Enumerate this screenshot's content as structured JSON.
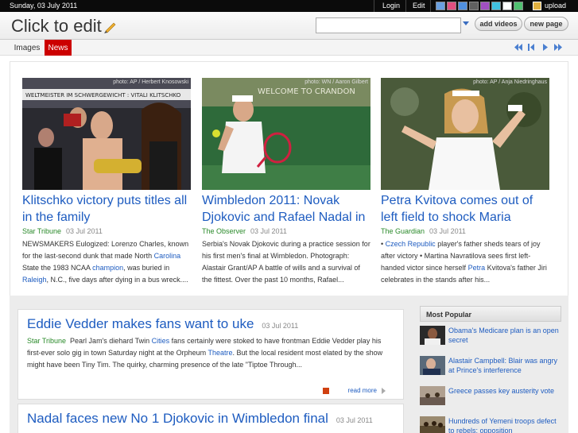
{
  "topbar": {
    "date": "Sunday, 03 July 2011",
    "login": "Login",
    "edit": "Edit",
    "swatches": [
      "#6aa0e0",
      "#e05080",
      "#5090e0",
      "#606060",
      "#a050c0",
      "#40c0e0",
      "#ffffff",
      "#50c070"
    ],
    "upload": "upload"
  },
  "header": {
    "title": "Click to edit",
    "search_value": "",
    "add_videos": "add videos",
    "new_page": "new page"
  },
  "nav": {
    "tabs": [
      "Images",
      "News"
    ],
    "active_tab": "News"
  },
  "features": [
    {
      "credit": "photo: AP / Herbert Knosowski",
      "title": "Klitschko victory puts titles all in the family",
      "source": "Star Tribune",
      "date": "03 Jul 2011",
      "ex_a": "NEWSMAKERS Eulogized: Lorenzo Charles, known for the last-second dunk that made North ",
      "ex_link1": "Carolina",
      "ex_b": " State the 1983 NCAA ",
      "ex_link2": "champion",
      "ex_c": ", was buried in ",
      "ex_link3": "Raleigh",
      "ex_d": ", N.C., five days after dying in a bus wreck...."
    },
    {
      "credit": "photo: WN / Aaron Gilbert",
      "title": "Wimbledon 2011: Novak Djokovic and Rafael Nadal in",
      "source": "The Observer",
      "date": "03 Jul 2011",
      "excerpt": "Serbia's Novak Djokovic during a practice session for his first men's final at Wimbledon. Photograph: Alastair Grant/AP A battle of wills and a survival of the fittest. Over the past 10 months, Rafael..."
    },
    {
      "credit": "photo: AP / Anja Niedringhaus",
      "title": "Petra Kvitova comes out of left field to shock Maria",
      "source": "The Guardian",
      "date": "03 Jul 2011",
      "ex_a": "• ",
      "ex_link1": "Czech Republic",
      "ex_b": " player's father sheds tears of joy after victory • Martina Navratilova sees first left-handed victor since herself ",
      "ex_link2": "Petra",
      "ex_c": " Kvitova's father Jiri celebrates in the stands after his..."
    }
  ],
  "articles": [
    {
      "title": "Eddie Vedder makes fans want to uke",
      "date": "03 Jul 2011",
      "source": "Star Tribune",
      "b_a": "Pearl Jam's diehard Twin ",
      "b_link1": "Cities",
      "b_b": " fans certainly were stoked to have frontman Eddie Vedder play his first-ever solo gig in town Saturday night at the Orpheum ",
      "b_link2": "Theatre",
      "b_c": ". But the local resident most elated by the show might have been Tiny Tim. The quirky, charming presence of the late \"Tiptoe Through...",
      "read_more": "read more"
    },
    {
      "title": "Nadal faces new No 1 Djokovic in Wimbledon final",
      "date": "03 Jul 2011"
    }
  ],
  "popular": {
    "heading": "Most Popular",
    "items": [
      "Obama's Medicare plan is an open secret",
      "Alastair Campbell: Blair was angry at Prince's interference",
      "Greece passes key austerity vote",
      "Hundreds of Yemeni troops defect to rebels: opposition"
    ]
  }
}
